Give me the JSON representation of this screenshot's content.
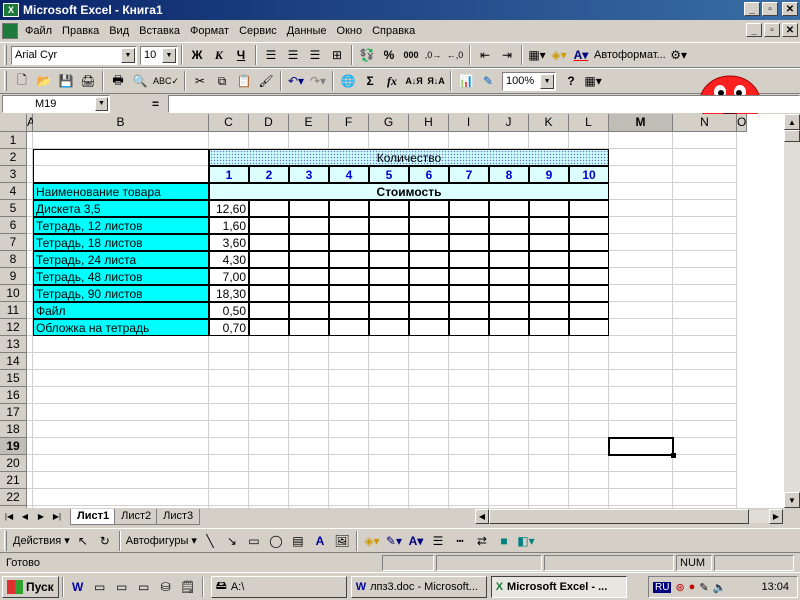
{
  "window": {
    "title": "Microsoft Excel - Книга1",
    "min": "_",
    "max": "▫",
    "close": "✕"
  },
  "menu": [
    "Файл",
    "Правка",
    "Вид",
    "Вставка",
    "Формат",
    "Сервис",
    "Данные",
    "Окно",
    "Справка"
  ],
  "format_toolbar": {
    "font": "Arial Cyr",
    "size": "10",
    "bold": "Ж",
    "italic": "К",
    "underline": "Ч",
    "autoformat": "Автоформат..."
  },
  "standard_toolbar": {
    "zoom": "100%"
  },
  "formula_bar": {
    "name_box": "M19",
    "equals": "=",
    "formula": ""
  },
  "columns": [
    "A",
    "B",
    "C",
    "D",
    "E",
    "F",
    "G",
    "H",
    "I",
    "J",
    "K",
    "L",
    "M",
    "N",
    "O"
  ],
  "rows": [
    "1",
    "2",
    "3",
    "4",
    "5",
    "6",
    "7",
    "8",
    "9",
    "10",
    "11",
    "12",
    "13",
    "14",
    "15",
    "16",
    "17",
    "18",
    "19",
    "20",
    "21",
    "22",
    "23"
  ],
  "sheet": {
    "quantity_label": "Количество",
    "quantity_numbers": [
      "1",
      "2",
      "3",
      "4",
      "5",
      "6",
      "7",
      "8",
      "9",
      "10"
    ],
    "product_header": "Наименование товара",
    "cost_header": "Стоимость",
    "products": [
      {
        "name": "Дискета 3,5",
        "price": "12,60"
      },
      {
        "name": "Тетрадь, 12 листов",
        "price": "1,60"
      },
      {
        "name": "Тетрадь, 18 листов",
        "price": "3,60"
      },
      {
        "name": "Тетрадь, 24 листа",
        "price": "4,30"
      },
      {
        "name": "Тетрадь, 48 листов",
        "price": "7,00"
      },
      {
        "name": "Тетрадь, 90 листов",
        "price": "18,30"
      },
      {
        "name": "Файл",
        "price": "0,50"
      },
      {
        "name": "Обложка на тетрадь",
        "price": "0,70"
      }
    ]
  },
  "sheet_tabs": [
    "Лист1",
    "Лист2",
    "Лист3"
  ],
  "draw_toolbar": {
    "actions": "Действия",
    "autoshapes": "Автофигуры"
  },
  "status": {
    "text": "Готово",
    "num": "NUM"
  },
  "taskbar": {
    "start": "Пуск",
    "tasks": [
      "A:\\",
      "лпз3.doc - Microsoft...",
      "Microsoft Excel - ..."
    ],
    "lang": "RU",
    "clock": "13:04"
  }
}
